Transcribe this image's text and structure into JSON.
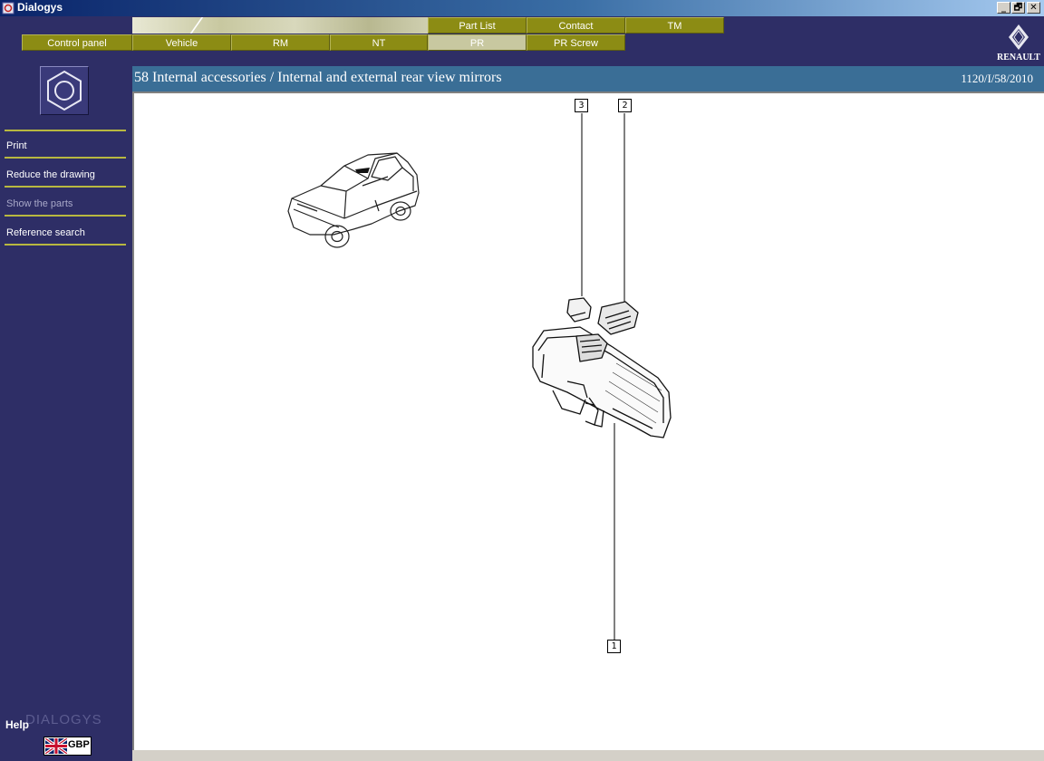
{
  "window": {
    "title": "Dialogys",
    "controls": {
      "minimize": "_",
      "maximize": "🗗",
      "close": "✕"
    }
  },
  "tabs": {
    "top_row": [
      {
        "label": "Part List"
      },
      {
        "label": "Contact"
      },
      {
        "label": "TM"
      }
    ],
    "bottom_row": [
      {
        "label": "Control panel"
      },
      {
        "label": "Vehicle"
      },
      {
        "label": "RM"
      },
      {
        "label": "NT"
      },
      {
        "label": "PR",
        "active": true
      },
      {
        "label": "PR Screw"
      }
    ]
  },
  "brand": {
    "name": "RENAULT",
    "icon": "renault-diamond-icon"
  },
  "sidebar": {
    "section_icon": "nut-icon",
    "items": [
      {
        "label": "Print",
        "enabled": true
      },
      {
        "label": "Reduce the drawing",
        "enabled": true
      },
      {
        "label": "Show the parts",
        "enabled": false
      },
      {
        "label": "Reference search",
        "enabled": true
      }
    ],
    "help_label": "Help",
    "watermark": "DIALOGYS",
    "currency": {
      "code": "GBP",
      "icon": "uk-flag-icon"
    }
  },
  "main": {
    "title": "58 Internal accessories / Internal and external rear view mirrors",
    "reference": "1120/I/58/2010",
    "callouts": [
      "3",
      "2",
      "1"
    ]
  },
  "colors": {
    "background": "#2e2e66",
    "tab": "#8c8c14",
    "tab_active": "#c8c8a0",
    "header_bar": "#3a6e96",
    "separator": "#b8b840"
  }
}
